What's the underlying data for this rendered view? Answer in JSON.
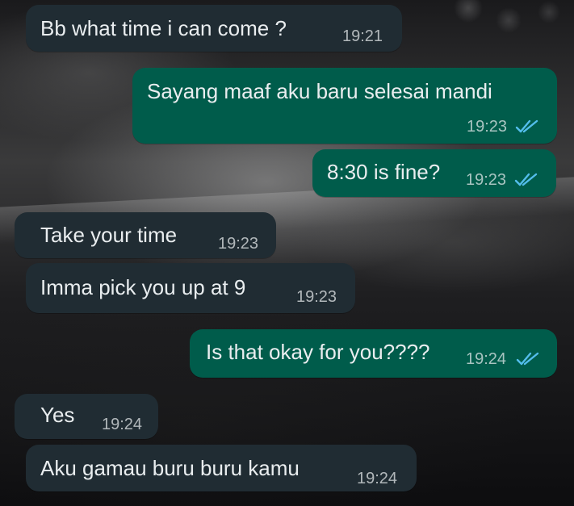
{
  "colors": {
    "incoming_bubble": "#202c33",
    "outgoing_bubble": "#005c4b",
    "read_receipt": "#53bdeb"
  },
  "messages": [
    {
      "direction": "incoming",
      "text": "Bb what time i can come ?",
      "time": "19:21"
    },
    {
      "direction": "outgoing",
      "text": "Sayang maaf aku baru selesai mandi",
      "time": "19:23",
      "status": "read"
    },
    {
      "direction": "outgoing",
      "text": "8:30 is fine?",
      "time": "19:23",
      "status": "read"
    },
    {
      "direction": "incoming",
      "text": "Take your time",
      "time": "19:23"
    },
    {
      "direction": "incoming",
      "text": "Imma pick you up at 9",
      "time": "19:23"
    },
    {
      "direction": "outgoing",
      "text": "Is that okay for you????",
      "time": "19:24",
      "status": "read"
    },
    {
      "direction": "incoming",
      "text": "Yes",
      "time": "19:24"
    },
    {
      "direction": "incoming",
      "text": "Aku gamau buru buru kamu",
      "time": "19:24"
    }
  ]
}
